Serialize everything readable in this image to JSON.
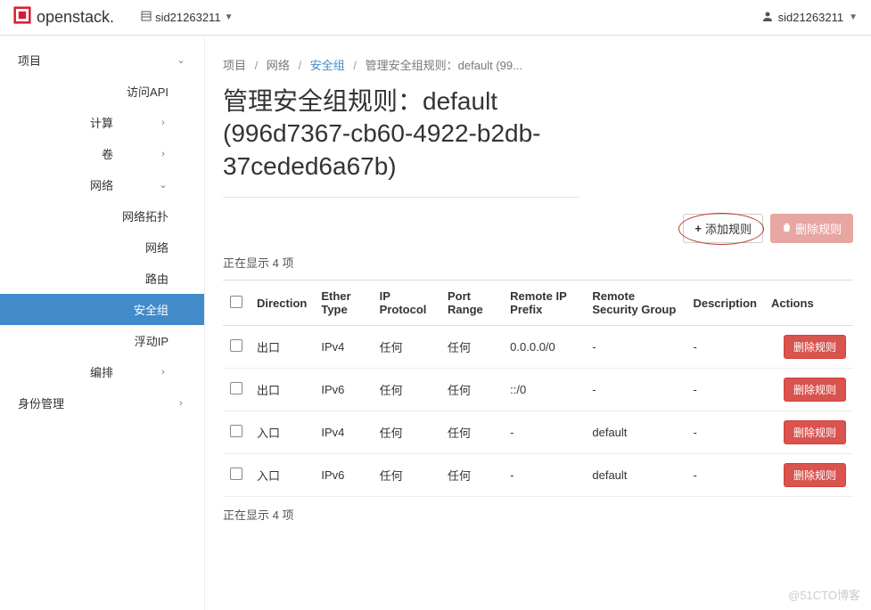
{
  "brand": "openstack.",
  "navbar": {
    "project": "sid21263211",
    "user": "sid21263211"
  },
  "sidebar": {
    "project_label": "项目",
    "access_api": "访问API",
    "compute": "计算",
    "volume": "卷",
    "network": "网络",
    "net_topology": "网络拓扑",
    "net_networks": "网络",
    "net_routers": "路由",
    "net_secgroups": "安全组",
    "net_floating": "浮动IP",
    "orchestration": "编排",
    "identity": "身份管理"
  },
  "breadcrumb": {
    "project": "项目",
    "network": "网络",
    "secgroups": "安全组",
    "current": "管理安全组规则：default (99..."
  },
  "page_title": "管理安全组规则：default (996d7367-cb60-4922-b2db-37ceded6a67b)",
  "toolbar": {
    "add_rule": "添加规则",
    "delete_rules": "删除规则"
  },
  "table": {
    "showing_top": "正在显示 4 项",
    "showing_bottom": "正在显示 4 项",
    "headers": {
      "direction": "Direction",
      "ether_type": "Ether Type",
      "ip_protocol": "IP Protocol",
      "port_range": "Port Range",
      "remote_ip": "Remote IP Prefix",
      "remote_sg": "Remote Security Group",
      "description": "Description",
      "actions": "Actions"
    },
    "delete_rule_label": "删除规则",
    "rows": [
      {
        "direction": "出口",
        "ether": "IPv4",
        "proto": "任何",
        "range": "任何",
        "remote_ip": "0.0.0.0/0",
        "remote_sg": "-",
        "desc": "-"
      },
      {
        "direction": "出口",
        "ether": "IPv6",
        "proto": "任何",
        "range": "任何",
        "remote_ip": "::/0",
        "remote_sg": "-",
        "desc": "-"
      },
      {
        "direction": "入口",
        "ether": "IPv4",
        "proto": "任何",
        "range": "任何",
        "remote_ip": "-",
        "remote_sg": "default",
        "desc": "-"
      },
      {
        "direction": "入口",
        "ether": "IPv6",
        "proto": "任何",
        "range": "任何",
        "remote_ip": "-",
        "remote_sg": "default",
        "desc": "-"
      }
    ]
  },
  "watermark": "@51CTO博客"
}
